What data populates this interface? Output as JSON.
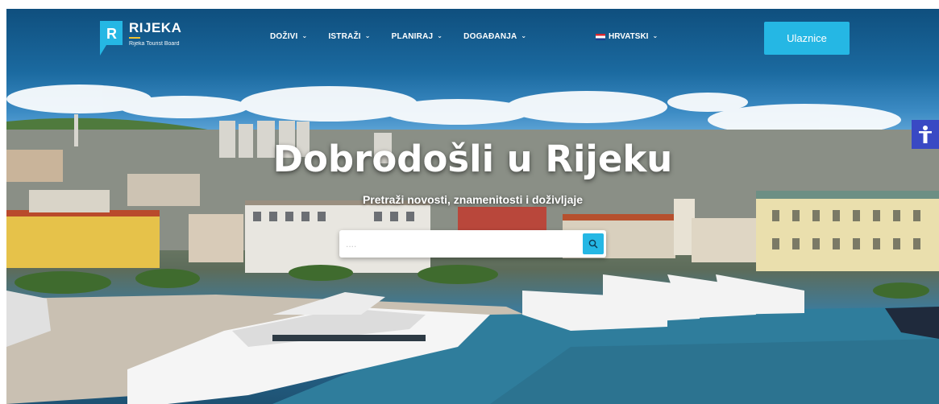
{
  "brand": {
    "name": "RIJEKA",
    "tagline": "Rijeka Tourist Board",
    "mark_letter": "R",
    "colors": {
      "accent": "#25b7e4",
      "mark": "#25b7e4",
      "bar": "#f2c230",
      "a11y": "#3949c4"
    }
  },
  "nav": {
    "items": [
      {
        "label": "DOŽIVI"
      },
      {
        "label": "ISTRAŽI"
      },
      {
        "label": "PLANIRAJ"
      },
      {
        "label": "DOGAĐANJA"
      }
    ],
    "chevron": "⌄"
  },
  "language": {
    "label": "HRVATSKI",
    "flag": "croatia-flag"
  },
  "cta": {
    "label": "Ulaznice"
  },
  "hero": {
    "title": "Dobrodošli u Rijeku",
    "subtitle": "Pretraži novosti, znamenitosti i doživljaje"
  },
  "search": {
    "placeholder": "....",
    "value": ""
  },
  "icons": {
    "search": "search-icon",
    "accessibility": "accessibility-icon"
  }
}
